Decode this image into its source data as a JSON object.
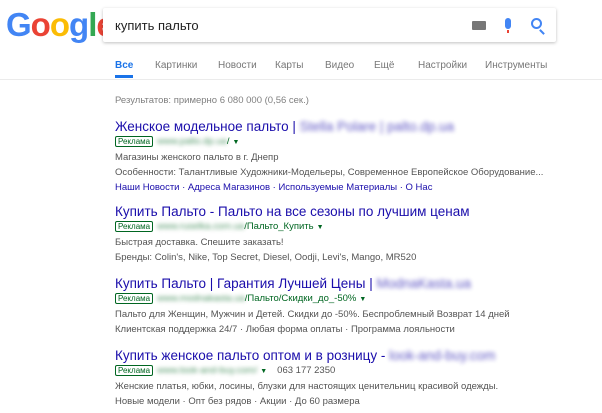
{
  "logo": {
    "letters": [
      "G",
      "o",
      "o",
      "g",
      "l",
      "e"
    ],
    "colors": [
      "#4285f4",
      "#ea4335",
      "#fbbc05",
      "#4285f4",
      "#34a853",
      "#ea4335"
    ]
  },
  "search": {
    "query": "купить пальто"
  },
  "tabs": [
    "Все",
    "Картинки",
    "Новости",
    "Карты",
    "Видео",
    "Ещё",
    "Настройки",
    "Инструменты"
  ],
  "stats": "Результатов: примерно 6 080 000 (0,56 сек.)",
  "ad_label": "Реклама",
  "results": [
    {
      "title": "Женское модельное пальто | ",
      "title_blur": "Stella Polare | palto.dp.ua",
      "url_blur": "www.palto.dp.ua",
      "url_path": "/",
      "desc": [
        "Магазины женского пальто в г. Днепр",
        "Особенности: Талантливые Художники-Модельеры, Современное Европейское Оборудование..."
      ],
      "links": "Наши Новости · Адреса Магазинов · Используемые Материалы · О Нас"
    },
    {
      "title": "Купить Пальто - Пальто на все сезоны по лучшим ценам",
      "url_blur": "www.ruselka.com.ua",
      "url_path": "/Пальто_Купить",
      "desc": [
        "Быстрая доставка. Спешите заказать!",
        "Бренды: Colin's, Nike, Top Secret, Diesel, Oodji, Levi's, Mango, MR520"
      ]
    },
    {
      "title": "Купить Пальто | Гарантия Лучшей Цены | ",
      "title_blur": "ModnaKasta.ua",
      "url_blur": "www.modnakasta.ua",
      "url_path": "/Пальто/Скидки_до_-50%",
      "desc": [
        "Пальто для Женщин, Мужчин и Детей. Скидки до -50%. Беспроблемный Возврат 14 дней",
        "Клиентская поддержка 24/7 · Любая форма оплаты · Программа лояльности"
      ]
    },
    {
      "title": "Купить женское пальто оптом и в розницу - ",
      "title_blur": "look-and-buy.com",
      "url_blur": "www.look-and-buy.com/",
      "phone": "063 177 2350",
      "desc": [
        "Женские платья, юбки, лосины, блузки для настоящих ценительниц красивой одежды."
      ],
      "links": "Новые модели · Опт без рядов · Акции · До 60 размера"
    }
  ]
}
